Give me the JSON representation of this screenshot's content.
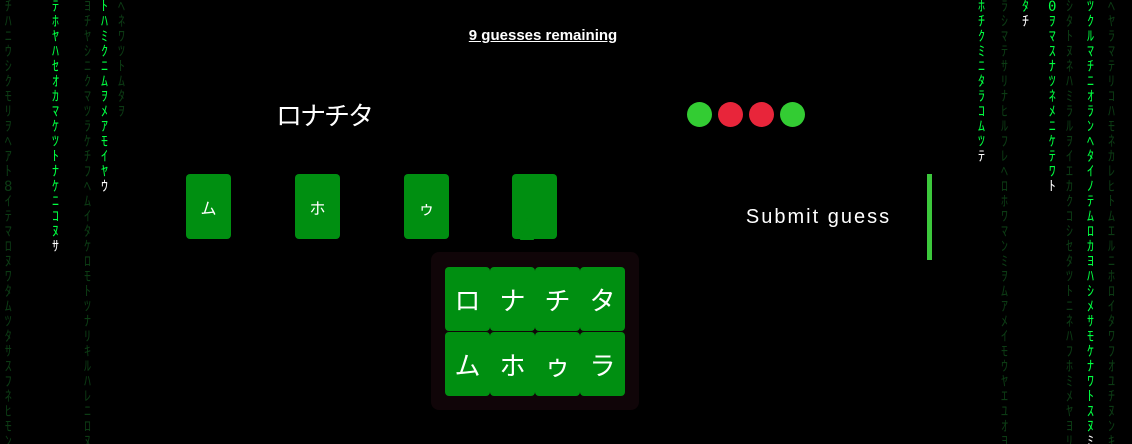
{
  "status": {
    "guesses_remaining": "9 guesses remaining"
  },
  "previous_guess": {
    "text": "ロナチタ",
    "feedback": [
      "#33cc33",
      "#e8253a",
      "#e8253a",
      "#33cc33"
    ]
  },
  "slots": [
    "ム",
    "ホ",
    "ゥ",
    ""
  ],
  "submit_label": "Submit guess",
  "picker": {
    "row1": [
      "ロ",
      "ナ",
      "チ",
      "タ"
    ],
    "row2": [
      "ム",
      "ホ",
      "ゥ",
      "ラ"
    ]
  },
  "colors": {
    "background": "#000000",
    "tile_green": "#008f11",
    "rain_bright": "#00ff41",
    "rain_dim": "#0c3b14",
    "feedback_correct": "#33cc33",
    "feedback_wrong": "#e8253a"
  },
  "rain": [
    {
      "chars": [
        "ﾁ",
        "ﾊ",
        "ﾆ",
        "ｳ",
        "ｼ",
        "ｸ",
        "ﾓ",
        "ﾘ",
        "ｦ",
        "ﾍ",
        "ｱ",
        "ﾄ",
        "8",
        "ｲ",
        "ﾃ",
        "ﾏ",
        "ﾛ",
        "ﾇ",
        "ﾜ",
        "ﾀ",
        "ﾑ",
        "ﾂ",
        "ﾀ",
        "ｻ",
        "ｽ",
        "ﾌ",
        "ﾈ",
        "ﾋ",
        "ﾓ",
        "ﾝ"
      ]
    },
    {
      "chars": [
        "ﾃ",
        "ﾎ",
        "ﾔ",
        "ﾊ",
        "ｾ",
        "ｵ",
        "ｶ",
        "ﾏ",
        "ｹ",
        "ﾂ",
        "ﾄ",
        "ﾅ",
        "ｹ",
        "ﾆ",
        "ｺ",
        "ﾇ",
        "ｻ",
        "ﾈ",
        "ｼ",
        "ﾉ",
        "ｽ",
        "ﾊ",
        "ｾ",
        "ﾋ",
        "ｿ",
        "ﾌ",
        "ﾀ",
        "ﾍ",
        "ﾁ",
        "ﾎ"
      ]
    },
    {
      "chars": [
        "ﾖ",
        "ﾁ",
        "ﾔ",
        "ｼ",
        "ﾆ",
        "ｸ",
        "ﾏ",
        "ﾂ",
        "ﾗ",
        "ｹ",
        "ﾁ",
        "ﾌ",
        "ﾍ",
        "ﾑ",
        "ｲ",
        "ﾀ",
        "ｹ",
        "ﾛ",
        "ﾓ",
        "ﾄ",
        "ﾂ",
        "ﾅ",
        "ﾘ",
        "ｷ",
        "ﾙ",
        "ﾊ",
        "ﾚ",
        "ﾆ",
        "ﾛ",
        "ﾇ"
      ]
    },
    {
      "chars": [
        "ﾄ",
        "ﾊ",
        "ﾐ",
        "ｸ",
        "ﾆ",
        "ﾑ",
        "ｦ",
        "ﾒ",
        "ｱ",
        "ﾓ",
        "ｲ",
        "ﾔ",
        "ｳ",
        "ﾕ",
        "ｴ",
        "ﾖ",
        "ｵ",
        "ﾗ",
        "ｶ",
        "ﾘ",
        "ｷ",
        "ﾙ",
        "ｸ",
        "ﾚ",
        "ｹ",
        "ﾛ",
        "ｺ",
        "ﾜ",
        "ｻ",
        "ﾝ"
      ]
    },
    {
      "chars": [
        "ﾍ",
        "ﾈ",
        "ﾜ",
        "ﾂ",
        "ﾄ",
        "ﾑ",
        "ﾀ",
        "ｦ",
        "ｷ",
        "ﾊ",
        "ﾁ",
        "ﾎ",
        "ﾓ",
        "ﾂ",
        "ﾏ",
        "ﾃ",
        "ﾐ",
        "ﾄ",
        "ﾑ",
        "ﾅ",
        "ﾒ",
        "ﾆ",
        "ﾓ",
        "ﾇ",
        "ﾔ",
        "ﾈ",
        "ﾕ",
        "ﾉ",
        "ﾖ",
        "ﾊ"
      ]
    },
    {
      "chars": [
        "ﾎ",
        "ﾁ",
        "ｸ",
        "ﾐ",
        "ﾆ",
        "ﾀ",
        "ﾗ",
        "ｺ",
        "ﾑ",
        "ﾂ",
        "ﾃ",
        "ﾍ",
        "ﾊ",
        "ｻ",
        "ﾉ",
        "ﾛ",
        "ﾋ",
        "ﾏ",
        "ﾆ",
        "ｼ",
        "ﾅ",
        "ﾖ",
        "ﾍ",
        "ﾘ",
        "ｽ",
        "ﾓ",
        "ﾑ",
        "ｾ",
        "ﾐ",
        "ｿ"
      ]
    },
    {
      "chars": [
        "ﾗ",
        "ｼ",
        "ﾏ",
        "ﾃ",
        "ｻ",
        "ﾘ",
        "ﾅ",
        "ﾋ",
        "ﾙ",
        "ﾌ",
        "ﾚ",
        "ﾍ",
        "ﾛ",
        "ﾎ",
        "ﾜ",
        "ﾏ",
        "ﾝ",
        "ﾐ",
        "ｦ",
        "ﾑ",
        "ｱ",
        "ﾒ",
        "ｲ",
        "ﾓ",
        "ｳ",
        "ﾔ",
        "ｴ",
        "ﾕ",
        "ｵ",
        "ﾖ"
      ]
    },
    {
      "chars": [
        "ﾀ",
        "ﾁ",
        "ﾂ",
        "ﾃ",
        "ﾄ",
        "ﾅ",
        "ﾆ",
        "ﾇ",
        "ﾈ",
        "ﾉ",
        "ﾊ",
        "ﾋ",
        "ﾌ",
        "ﾍ",
        "ﾎ",
        "ﾏ",
        "ﾐ",
        "ﾑ",
        "ﾒ",
        "ﾓ",
        "ﾔ",
        "ﾕ",
        "ﾖ",
        "ﾗ",
        "ﾘ",
        "ﾙ",
        "ﾚ",
        "ﾛ",
        "ﾜ",
        "ﾝ"
      ]
    },
    {
      "chars": [
        "0",
        "ｦ",
        "ﾏ",
        "ｽ",
        "ﾅ",
        "ﾂ",
        "ﾈ",
        "ﾒ",
        "ﾆ",
        "ｹ",
        "ﾃ",
        "ﾜ",
        "ﾄ",
        "ｱ",
        "ﾉ",
        "ｷ",
        "ﾊ",
        "ｸ",
        "ﾋ",
        "ｺ",
        "ﾌ",
        "ｻ",
        "ﾍ",
        "ｼ",
        "ﾎ",
        "ｽ",
        "ﾏ",
        "ｾ",
        "ﾐ",
        "ｿ"
      ]
    },
    {
      "chars": [
        "ｼ",
        "ﾀ",
        "ﾄ",
        "ﾇ",
        "ﾈ",
        "ﾊ",
        "ﾐ",
        "ﾗ",
        "ﾙ",
        "ｦ",
        "ｲ",
        "ｴ",
        "ｶ",
        "ｸ",
        "ｺ",
        "ｼ",
        "ｾ",
        "ﾀ",
        "ﾂ",
        "ﾄ",
        "ﾆ",
        "ﾈ",
        "ﾊ",
        "ﾌ",
        "ﾎ",
        "ﾐ",
        "ﾒ",
        "ﾔ",
        "ﾖ",
        "ﾘ"
      ]
    },
    {
      "chars": [
        "ﾂ",
        "ｸ",
        "ﾙ",
        "ﾏ",
        "ﾁ",
        "ﾆ",
        "ｵ",
        "ﾗ",
        "ﾝ",
        "ﾍ",
        "ﾀ",
        "ｲ",
        "ﾉ",
        "ﾃ",
        "ﾑ",
        "ﾛ",
        "ｶ",
        "ﾖ",
        "ﾊ",
        "ｼ",
        "ﾒ",
        "ｻ",
        "ﾓ",
        "ｹ",
        "ﾅ",
        "ﾜ",
        "ﾄ",
        "ｽ",
        "ﾇ",
        "ﾐ"
      ]
    },
    {
      "chars": [
        "ﾍ",
        "ﾔ",
        "ﾗ",
        "ﾏ",
        "ﾃ",
        "ﾘ",
        "ｺ",
        "ﾊ",
        "ﾓ",
        "ﾈ",
        "ｶ",
        "ﾚ",
        "ﾋ",
        "ﾄ",
        "ﾑ",
        "ｴ",
        "ﾙ",
        "ﾆ",
        "ﾎ",
        "ﾛ",
        "ｲ",
        "ﾀ",
        "ﾜ",
        "ﾌ",
        "ｵ",
        "ﾕ",
        "ﾁ",
        "ﾇ",
        "ﾝ",
        "ｷ"
      ]
    }
  ]
}
